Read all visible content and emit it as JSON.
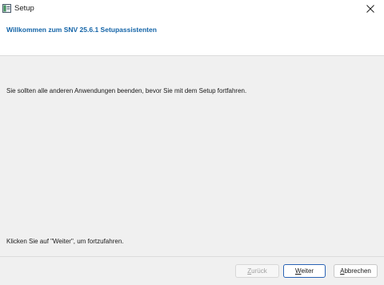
{
  "window": {
    "title": "Setup",
    "icon": "installer-icon",
    "close_icon": "close-icon"
  },
  "header": {
    "title": "Willkommen zum SNV 25.6.1 Setupassistenten"
  },
  "content": {
    "intro": "Sie sollten alle anderen Anwendungen beenden, bevor Sie mit dem Setup fortfahren.",
    "continue_hint": "Klicken Sie auf \"Weiter\", um fortzufahren."
  },
  "buttons": {
    "back": {
      "label_first": "Z",
      "label_rest": "urück",
      "enabled": false
    },
    "next": {
      "label_first": "W",
      "label_rest": "eiter",
      "enabled": true
    },
    "cancel": {
      "label_first": "A",
      "label_rest": "bbrechen",
      "enabled": true
    }
  },
  "colors": {
    "header_title": "#1565a8",
    "default_button_border": "#2a63b5",
    "background": "#f0f0f0"
  }
}
